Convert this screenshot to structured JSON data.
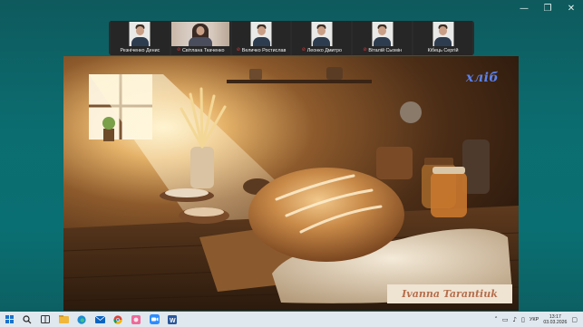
{
  "window_controls": {
    "minimize": "—",
    "maximize": "❐",
    "close": "✕"
  },
  "participants": [
    {
      "name": "Резніченко Денис",
      "muted": false,
      "camera": "man"
    },
    {
      "name": "Світлана Ткаченко",
      "muted": true,
      "camera": "woman"
    },
    {
      "name": "Величко Ростислав",
      "muted": true,
      "camera": "man"
    },
    {
      "name": "Леонко Дмитро",
      "muted": true,
      "camera": "man"
    },
    {
      "name": "Віталій Сьомін",
      "muted": true,
      "camera": "man"
    },
    {
      "name": "Кібець Сергій",
      "muted": false,
      "camera": "man"
    }
  ],
  "slide": {
    "logo_text": "хліб",
    "signature": "Ivanna Tarantiuk"
  },
  "taskbar": {
    "apps": [
      "windows-start-icon",
      "search-icon",
      "task-view-icon",
      "file-explorer-icon",
      "edge-icon",
      "mail-icon",
      "chrome-icon",
      "photos-icon",
      "zoom-icon",
      "word-icon"
    ],
    "language": "УКР",
    "time": "13:17",
    "date": "03.03.2026"
  },
  "colors": {
    "desktop": "#0b6d70",
    "taskbar": "#dfe8ef",
    "logo": "#5a82f0",
    "signature_text": "#b56e4c",
    "muted_mic": "#e23a3a"
  }
}
